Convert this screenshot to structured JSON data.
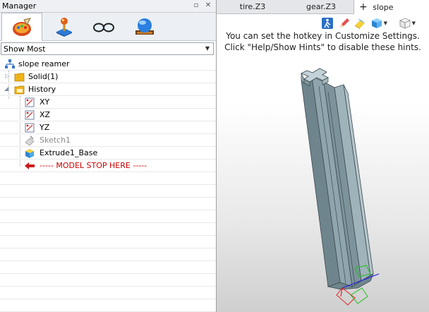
{
  "manager": {
    "title": "Manager",
    "pin_icon": "pin-icon",
    "close_icon": "close-icon",
    "tabs": [
      {
        "icon": "palette-history-icon"
      },
      {
        "icon": "joystick-icon"
      },
      {
        "icon": "glasses-view-icon"
      },
      {
        "icon": "globe-icon"
      }
    ],
    "filter": {
      "value": "Show Most"
    },
    "tree": {
      "root": "slope reamer",
      "solid": "Solid(1)",
      "history": "History",
      "xy": "XY",
      "xz": "XZ",
      "yz": "YZ",
      "sketch": "Sketch1",
      "extrude": "Extrude1_Base",
      "stop": "----- MODEL STOP HERE -----"
    }
  },
  "doc_tabs": {
    "tab1": "tire.Z3",
    "tab2": "gear.Z3",
    "tab3": "slope reamer.Z",
    "add_icon": "plus-icon"
  },
  "viewport": {
    "hint_line1": "You can set the hotkey in Customize Settings.",
    "hint_line2": "Click \"Help/Show Hints\" to disable these hints.",
    "tools": [
      "walk-icon",
      "pencil-icon",
      "eraser-icon",
      "render-mode-icon",
      "view-cube-icon"
    ],
    "colors": {
      "body_face": "#8fa5ad",
      "body_dark": "#6f858d",
      "body_light": "#b6c6cc"
    }
  }
}
